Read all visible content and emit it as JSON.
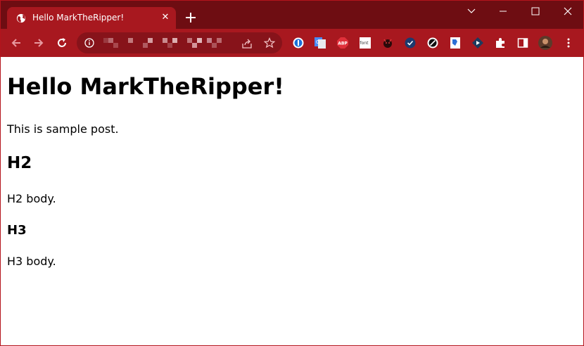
{
  "browser": {
    "tab": {
      "title": "Hello MarkTheRipper!",
      "close_glyph": "✕"
    },
    "new_tab_icon": "plus-icon",
    "window_controls": [
      "chevron-down-icon",
      "minimize-icon",
      "maximize-icon",
      "close-icon"
    ],
    "nav": [
      "back-icon",
      "forward-icon",
      "reload-icon"
    ],
    "omnibox": {
      "url": "",
      "url_pixelated": true,
      "actions": [
        "share-icon",
        "star-icon"
      ]
    },
    "extensions": [
      "1password-icon",
      "google-translate-icon",
      "adblock-plus-icon",
      "font-icon",
      "devil-icon",
      "check-shield-icon",
      "block-icon",
      "bookmark-page-icon",
      "diamond-icon",
      "puzzle-icon",
      "sidepanel-icon",
      "profile-avatar",
      "menu-icon"
    ],
    "colors": {
      "tabstrip": "#6e0d12",
      "tab_active": "#a8181f",
      "toolbar": "#a8181f",
      "omnibox": "#87131a"
    }
  },
  "page": {
    "h1": "Hello MarkTheRipper!",
    "p1": "This is sample post.",
    "h2": "H2",
    "p2": "H2 body.",
    "h3": "H3",
    "p3": "H3 body."
  }
}
